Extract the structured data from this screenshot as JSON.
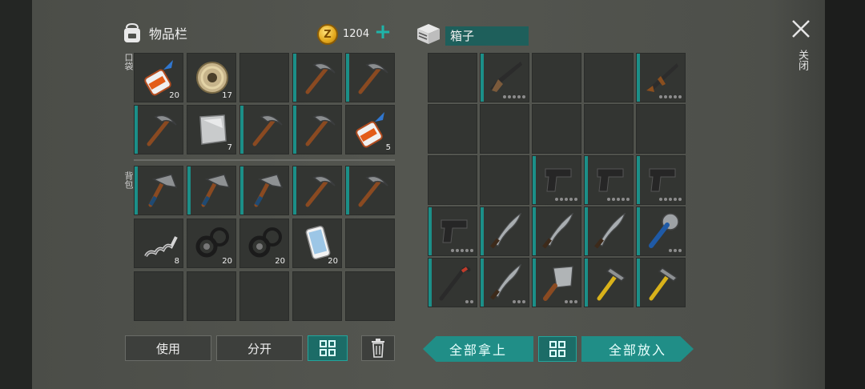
{
  "inventory": {
    "title": "物品栏",
    "coins": "1204",
    "pocket_label": "口袋",
    "backpack_label": "背包"
  },
  "pocket_slots": [
    {
      "item": "glue-icon",
      "qty": "20",
      "teal": false
    },
    {
      "item": "wire-spool-icon",
      "qty": "17",
      "teal": false
    },
    {
      "item": "",
      "qty": "",
      "teal": false
    },
    {
      "item": "pickaxe-icon",
      "qty": "",
      "teal": true
    },
    {
      "item": "pickaxe-icon",
      "qty": "",
      "teal": true
    },
    {
      "item": "pickaxe-icon",
      "qty": "",
      "teal": true
    },
    {
      "item": "metal-sheet-icon",
      "qty": "7",
      "teal": false
    },
    {
      "item": "pickaxe-icon",
      "qty": "",
      "teal": true
    },
    {
      "item": "pickaxe-icon",
      "qty": "",
      "teal": true
    },
    {
      "item": "glue-icon",
      "qty": "5",
      "teal": false
    }
  ],
  "backpack_slots": [
    {
      "item": "hatchet-icon",
      "qty": "",
      "teal": true
    },
    {
      "item": "hatchet-icon",
      "qty": "",
      "teal": true
    },
    {
      "item": "hatchet-icon",
      "qty": "",
      "teal": true
    },
    {
      "item": "pickaxe-icon",
      "qty": "",
      "teal": true
    },
    {
      "item": "pickaxe-icon",
      "qty": "",
      "teal": true
    },
    {
      "item": "spring-icon",
      "qty": "8",
      "teal": false
    },
    {
      "item": "gasket-icon",
      "qty": "20",
      "teal": false
    },
    {
      "item": "gasket-icon",
      "qty": "20",
      "teal": false
    },
    {
      "item": "smartphone-icon",
      "qty": "20",
      "teal": false
    },
    {
      "item": "",
      "qty": "",
      "teal": false
    },
    {
      "item": "",
      "qty": "",
      "teal": false
    },
    {
      "item": "",
      "qty": "",
      "teal": false
    },
    {
      "item": "",
      "qty": "",
      "teal": false
    },
    {
      "item": "",
      "qty": "",
      "teal": false
    },
    {
      "item": "",
      "qty": "",
      "teal": false
    }
  ],
  "box": {
    "title": "箱子"
  },
  "box_slots": [
    {
      "item": "",
      "teal": false,
      "dots": 0
    },
    {
      "item": "shotgun-icon",
      "teal": true,
      "dots": 5
    },
    {
      "item": "",
      "teal": false,
      "dots": 0
    },
    {
      "item": "",
      "teal": false,
      "dots": 0
    },
    {
      "item": "rifle-icon",
      "teal": true,
      "dots": 5
    },
    {
      "item": "",
      "teal": false,
      "dots": 0
    },
    {
      "item": "",
      "teal": false,
      "dots": 0
    },
    {
      "item": "",
      "teal": false,
      "dots": 0
    },
    {
      "item": "",
      "teal": false,
      "dots": 0
    },
    {
      "item": "",
      "teal": false,
      "dots": 0
    },
    {
      "item": "",
      "teal": false,
      "dots": 0
    },
    {
      "item": "",
      "teal": false,
      "dots": 0
    },
    {
      "item": "pistol-icon",
      "teal": true,
      "dots": 5
    },
    {
      "item": "pistol-icon",
      "teal": true,
      "dots": 5
    },
    {
      "item": "pistol-icon",
      "teal": true,
      "dots": 5
    },
    {
      "item": "pistol-icon",
      "teal": true,
      "dots": 5
    },
    {
      "item": "machete-icon",
      "teal": true,
      "dots": 0
    },
    {
      "item": "machete-icon",
      "teal": true,
      "dots": 0
    },
    {
      "item": "machete-icon",
      "teal": true,
      "dots": 0
    },
    {
      "item": "saw-club-icon",
      "teal": true,
      "dots": 3
    },
    {
      "item": "crowbar-icon",
      "teal": true,
      "dots": 2
    },
    {
      "item": "machete-icon",
      "teal": true,
      "dots": 3
    },
    {
      "item": "cleaver-icon",
      "teal": true,
      "dots": 3
    },
    {
      "item": "hammer-icon",
      "teal": true,
      "dots": 0
    },
    {
      "item": "hammer-icon",
      "teal": true,
      "dots": 0
    }
  ],
  "buttons": {
    "use": "使用",
    "split": "分开",
    "take_all": "全部拿上",
    "put_all": "全部放入"
  },
  "close_label": "关闭",
  "colors": {
    "teal": "#1b8f88",
    "slot": "#333532",
    "panel": "#545650"
  }
}
